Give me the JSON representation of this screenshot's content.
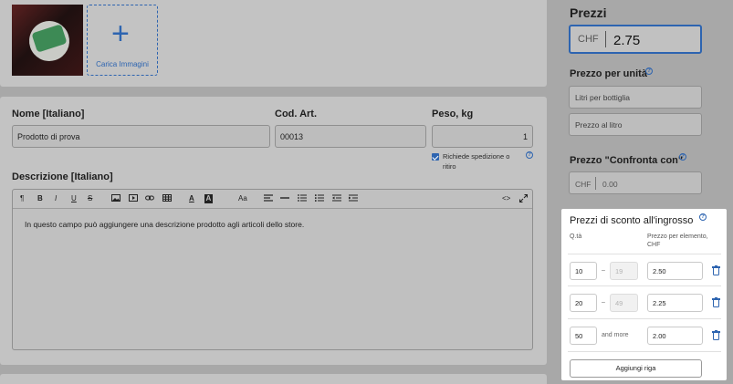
{
  "images": {
    "upload_label": "Carica Immagini",
    "plus_symbol": "+"
  },
  "form": {
    "name_label": "Nome [Italiano]",
    "name_value": "Prodotto di prova",
    "sku_label": "Cod. Art.",
    "sku_value": "00013",
    "weight_label": "Peso, kg",
    "weight_value": "1",
    "shipping_checkbox_label": "Richiede spedizione o ritiro",
    "shipping_checked": true,
    "description_label": "Descrizione [Italiano]",
    "description_text": "In questo campo può aggiungere una descrizione prodotto agli articoli dello store."
  },
  "toolbar": {
    "paragraph": "¶",
    "bold": "B",
    "italic": "I",
    "underline": "U",
    "strike": "S",
    "image": "image-icon",
    "video": "video-icon",
    "link": "link-icon",
    "table": "table-icon",
    "font_color": "A",
    "bg_color": "A",
    "case": "Aa",
    "align": "align-icon",
    "hr": "hr-icon",
    "ul": "ul-icon",
    "ol": "ol-icon",
    "outdent": "outdent-icon",
    "indent": "indent-icon",
    "code": "<>",
    "fullscreen": "fullscreen-icon"
  },
  "pricing": {
    "title": "Prezzi",
    "currency": "CHF",
    "price": "2.75",
    "unit_price_title": "Prezzo per unità",
    "unit_placeholder_1": "Litri per bottiglia",
    "unit_placeholder_2": "Prezzo al litro",
    "compare_title": "Prezzo \"Confronta con\"",
    "compare_currency": "CHF",
    "compare_value": "0.00"
  },
  "wholesale": {
    "title": "Prezzi di sconto all'ingrosso",
    "col_qty": "Q.tà",
    "col_price": "Prezzo per elemento, CHF",
    "rows": [
      {
        "from": "10",
        "sep": "–",
        "to": "19",
        "price": "2.50"
      },
      {
        "from": "20",
        "sep": "–",
        "to": "49",
        "price": "2.25"
      },
      {
        "from": "50",
        "sep": "and more",
        "to": "",
        "price": "2.00"
      }
    ],
    "add_row_label": "Aggiungi riga"
  },
  "colors": {
    "accent": "#2d64b0",
    "dim_overlay": "#a8a8a8",
    "panel_highlight": "#ffffff"
  }
}
